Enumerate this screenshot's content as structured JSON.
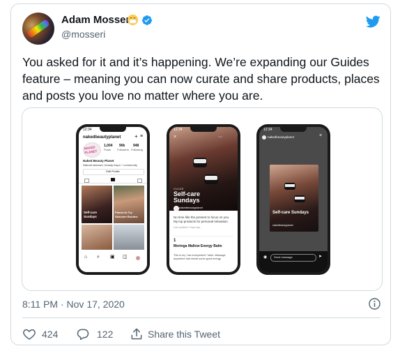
{
  "author": {
    "name": "Adam Mosseri",
    "handle": "@mosseri",
    "avatar_icon": "avatar",
    "emoji_icon": "face-with-medical-mask-icon",
    "verified_color": "#1d9bf0"
  },
  "tweet": {
    "text": "You asked for it and it’s happening. We’re expanding our Guides feature – meaning you can now curate and share products, places and posts you love no matter where you are.",
    "meta": "8:11 PM · Nov 17, 2020"
  },
  "media": {
    "phones": [
      {
        "time": "12:34",
        "username": "nakedbeautyplanet",
        "logo_text": "NAKED PLANET",
        "stats": [
          {
            "value": "1,004",
            "label": "Posts"
          },
          {
            "value": "90k",
            "label": "Followers"
          },
          {
            "value": "948",
            "label": "Following"
          }
        ],
        "bio_name": "Naked Beauty Planet",
        "bio_line": "Natural skincare, beauty inspo + community",
        "edit_label": "Edit Profile",
        "tiles": [
          "Self-care Sundays",
          "Places to Try Skincare Routine"
        ]
      },
      {
        "time": "12:34",
        "guide_kicker": "GUIDE",
        "guide_title": "Self-care Sundays",
        "guide_user": "nakedbeautyplanet",
        "guide_body": "No time like the present to focus on you. My top products for personal relaxation.",
        "guide_updated": "Last updated 2 days ago",
        "item_title": "Moringa Mallow Energy Balm",
        "item_body": "This is my \"use-everywhere\" balm. Massage anywhere that needs some good energy."
      },
      {
        "time": "12:34",
        "username": "nakedbeautyplanet",
        "card_title": "Self-care Sundays",
        "card_user": "nakedbeautyplanet",
        "send_label": "Send message"
      }
    ]
  },
  "actions": {
    "like_count": "424",
    "reply_count": "122",
    "share_label": "Share this Tweet"
  },
  "colors": {
    "text_primary": "#0f1419",
    "text_secondary": "#536471",
    "border": "#cfd9de",
    "twitter_blue": "#1d9bf0"
  }
}
